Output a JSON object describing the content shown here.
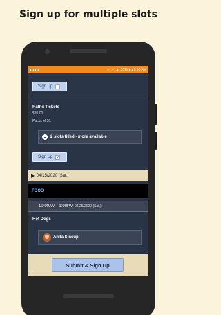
{
  "headline": "Sign up for multiple slots",
  "status_bar": {
    "battery": "33%",
    "time": "5:55 AM"
  },
  "sections": {
    "top_signup_label": "Sign Up",
    "item": {
      "title": "Raffle Tickets",
      "price": "$20.00",
      "description": "Packs of 30.",
      "slots_status": "2 slots filled - more available",
      "signup_label": "Sign Up",
      "signup_checked": true
    }
  },
  "date_bar": {
    "date": "04/25/2020 (Sat.)"
  },
  "category": {
    "label": "FOOD"
  },
  "time_slot": {
    "time": "10:00AM - 1:00PM",
    "date": "04/25/2020 (Sat.)"
  },
  "food_item": {
    "title": "Hot Dogs",
    "person": "Anita Sineup"
  },
  "footer": {
    "submit_label": "Submit & Sign Up"
  },
  "colors": {
    "page_bg": "#fbf3da",
    "status_bar": "#f28a1d",
    "screen_bg": "#2a3447",
    "accent_button": "#a9c3eb",
    "date_bar": "#e8dcb8",
    "category_text": "#8ab4ff"
  }
}
